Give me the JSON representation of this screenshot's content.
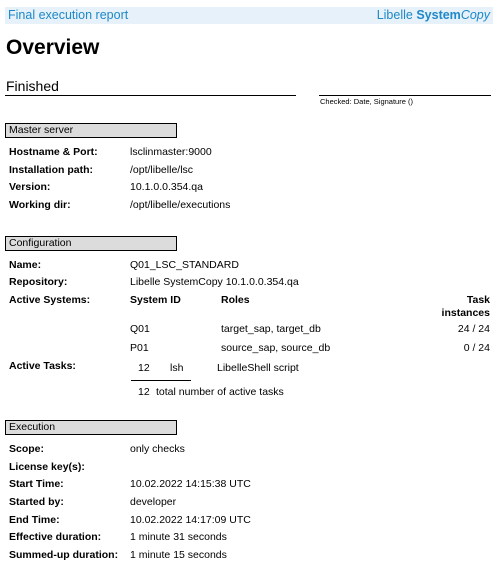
{
  "header": {
    "report_title": "Final execution report",
    "brand_prefix": "Libelle ",
    "brand_bold": "System",
    "brand_italic": "Copy"
  },
  "page_title": "Overview",
  "status": "Finished",
  "checked_label": "Checked: Date, Signature ()",
  "master_server": {
    "section_title": "Master server",
    "hostname_label": "Hostname & Port:",
    "hostname_value": "lsclinmaster:9000",
    "install_label": "Installation path:",
    "install_value": "/opt/libelle/lsc",
    "version_label": "Version:",
    "version_value": "10.1.0.0.354.qa",
    "workdir_label": "Working dir:",
    "workdir_value": "/opt/libelle/executions"
  },
  "configuration": {
    "section_title": "Configuration",
    "name_label": "Name:",
    "name_value": "Q01_LSC_STANDARD",
    "repo_label": "Repository:",
    "repo_value": "Libelle SystemCopy 10.1.0.0.354.qa",
    "active_systems_label": "Active Systems:",
    "systems_header": {
      "system_id": "System ID",
      "roles": "Roles",
      "task_instances_1": "Task",
      "task_instances_2": "instances"
    },
    "systems": [
      {
        "id": "Q01",
        "roles": "target_sap, target_db",
        "instances": "24 / 24"
      },
      {
        "id": "P01",
        "roles": "source_sap, source_db",
        "instances": "0 / 24"
      }
    ],
    "active_tasks_label": "Active Tasks:",
    "tasks": [
      {
        "count": "12",
        "code": "lsh",
        "description": "LibelleShell script"
      }
    ],
    "total_count": "12",
    "total_label": "total number of active tasks"
  },
  "execution": {
    "section_title": "Execution",
    "scope_label": "Scope:",
    "scope_value": "only checks",
    "license_label": "License key(s):",
    "license_value": "",
    "start_label": "Start Time:",
    "start_value": "10.02.2022 14:15:38 UTC",
    "started_by_label": "Started by:",
    "started_by_value": "developer",
    "end_label": "End Time:",
    "end_value": "10.02.2022 14:17:09 UTC",
    "effective_label": "Effective duration:",
    "effective_value": "1 minute  31 seconds",
    "summed_label": "Summed-up duration:",
    "summed_value": "1 minute  15 seconds"
  }
}
